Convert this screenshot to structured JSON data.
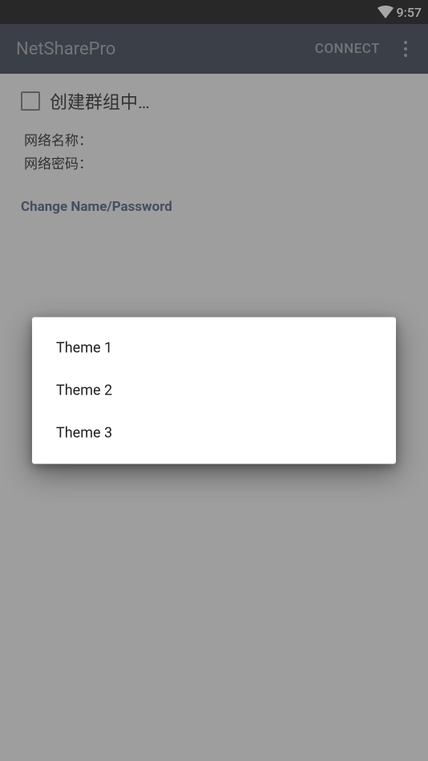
{
  "statusBar": {
    "time": "9:57"
  },
  "appBar": {
    "title": "NetSharePro",
    "connectLabel": "CONNECT"
  },
  "content": {
    "checkboxLabel": "创建群组中…",
    "networkNameLabel": "网络名称：",
    "networkPasswordLabel": "网络密码：",
    "changeLink": "Change Name/Password"
  },
  "dialog": {
    "items": [
      {
        "label": "Theme 1"
      },
      {
        "label": "Theme 2"
      },
      {
        "label": "Theme 3"
      }
    ]
  }
}
